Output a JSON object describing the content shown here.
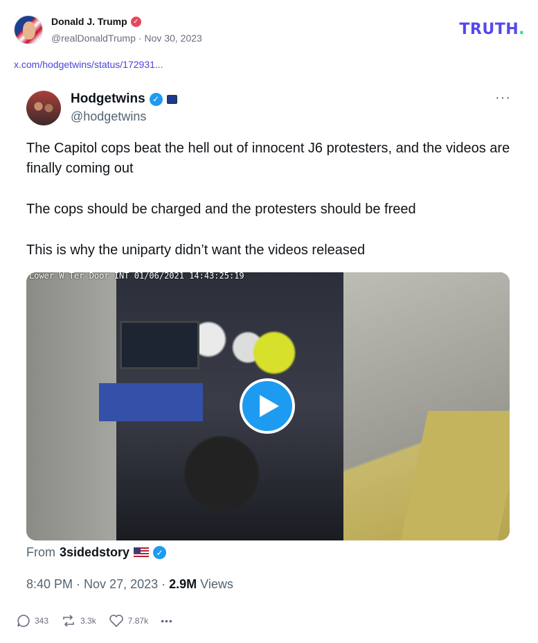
{
  "post": {
    "author_name": "Donald J. Trump",
    "author_handle": "@realDonaldTrump",
    "separator": "·",
    "date": "Nov 30, 2023",
    "link_text": "x.com/hodgetwins/status/172931...",
    "logo_text": "TRUTH",
    "logo_dot": ".",
    "verified_icon": "verified-check-icon",
    "colors": {
      "brand": "#5448ee",
      "brand_dot": "#17e2a4",
      "verified": "#e8465a"
    }
  },
  "tweet": {
    "name": "Hodgetwins",
    "handle": "@hodgetwins",
    "more": "···",
    "paragraphs": [
      "The Capitol cops beat the hell out of innocent J6 protesters, and the videos are finally coming out",
      "The cops should be charged and the protesters should be freed",
      "This is why the uniparty didn’t want the videos released"
    ],
    "video_timestamp": "Lower W Ter Door INT  01/06/2021 14:43:25:19",
    "from_label": "From",
    "from_source": "3sidedstory",
    "time": "8:40 PM",
    "separator": "·",
    "date": "Nov 27, 2023",
    "views_count": "2.9M",
    "views_label": "Views",
    "colors": {
      "verified": "#1d9bf0",
      "text": "#0f1419",
      "muted": "#536471"
    }
  },
  "actions": {
    "replies": "343",
    "retruths": "3.3k",
    "likes": "7.87k",
    "more": "•••"
  }
}
